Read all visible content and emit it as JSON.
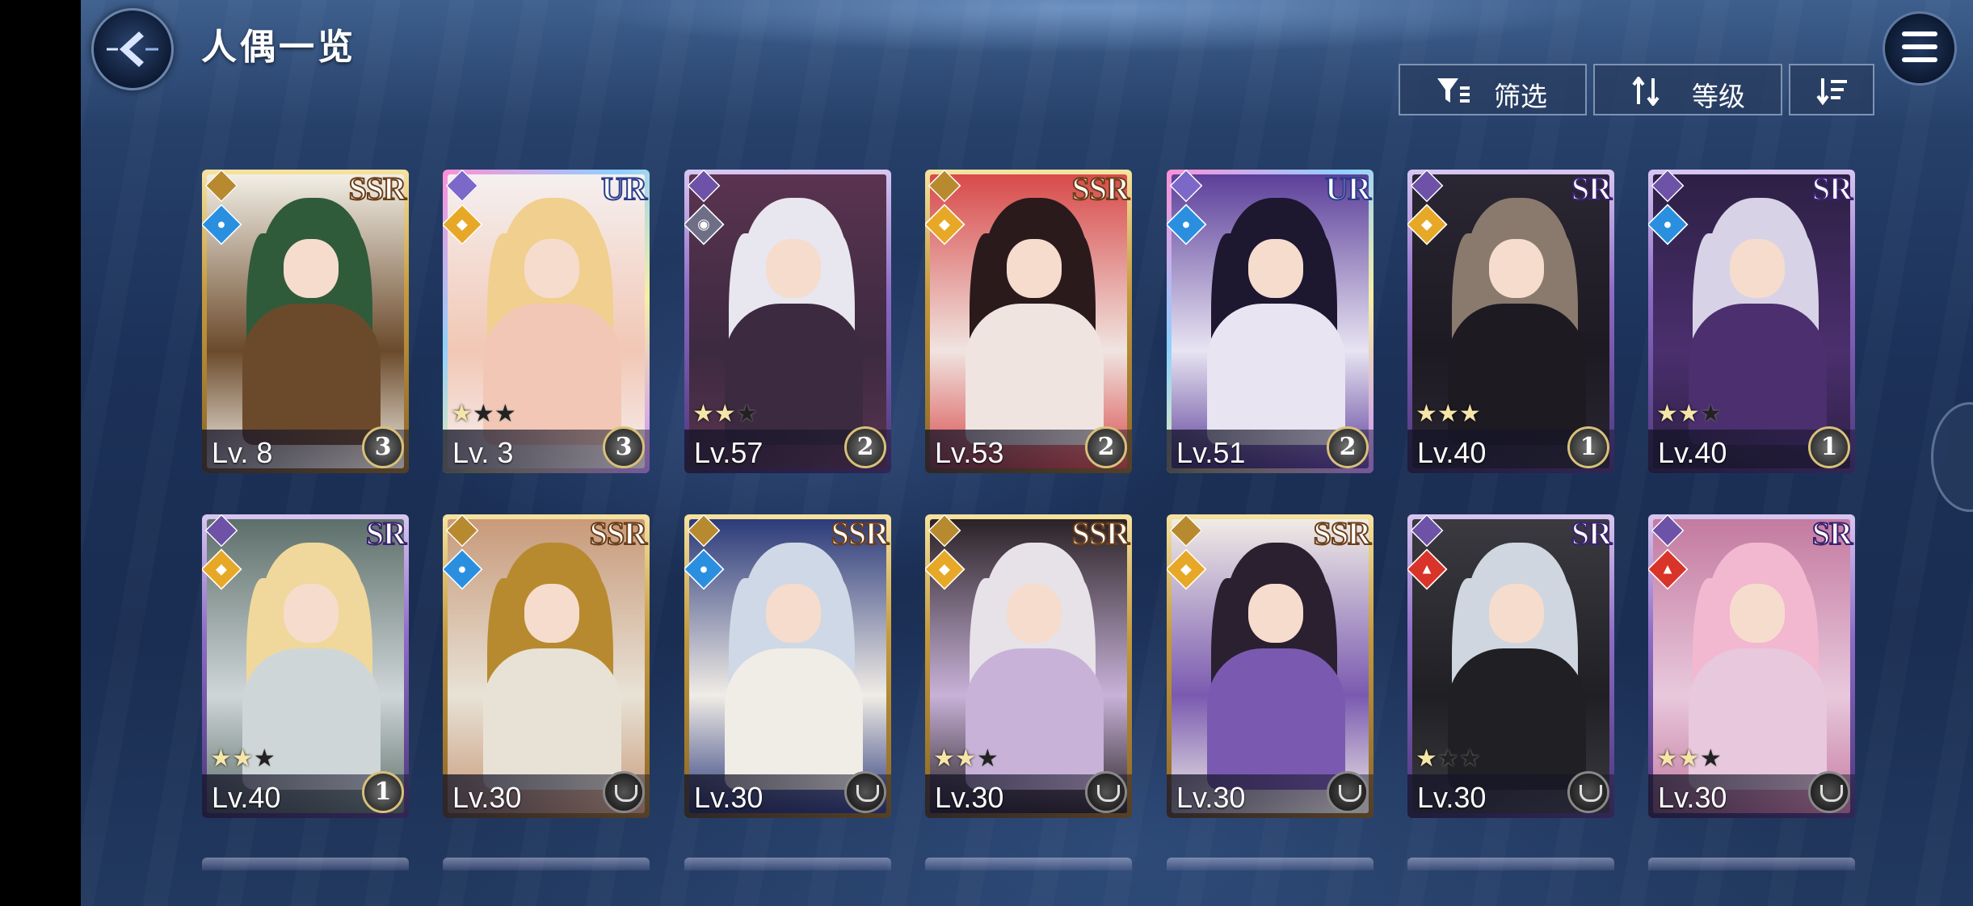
{
  "header": {
    "title": "人偶一览",
    "filter_label": "筛选",
    "sort_label": "等级"
  },
  "cards": [
    {
      "rarity": "SSR",
      "frame": "gold",
      "element": "water",
      "level": "Lv. 8",
      "stars": 0,
      "badge": "3",
      "art": [
        "#2f5b3a",
        "#6b4a2b",
        "#f2efe6"
      ]
    },
    {
      "rarity": "UR",
      "frame": "ur",
      "element": "light",
      "level": "Lv. 3",
      "stars": 1,
      "badge": "3",
      "art": [
        "#f1cf8e",
        "#f2c7b5",
        "#f5f0f0"
      ]
    },
    {
      "rarity": "",
      "frame": "purple",
      "element": "dark",
      "level": "Lv.57",
      "stars": 2,
      "badge": "2",
      "art": [
        "#e8e6ee",
        "#3c2a40",
        "#5a3350"
      ]
    },
    {
      "rarity": "SSR",
      "frame": "gold",
      "element": "light",
      "level": "Lv.53",
      "stars": 0,
      "badge": "2",
      "art": [
        "#2b1a1c",
        "#f0e4e0",
        "#d84a4a"
      ]
    },
    {
      "rarity": "UR",
      "frame": "ur",
      "element": "water",
      "level": "Lv.51",
      "stars": 0,
      "badge": "2",
      "art": [
        "#1d1730",
        "#e8e4f2",
        "#5c3f9a"
      ]
    },
    {
      "rarity": "SR",
      "frame": "purple",
      "element": "light",
      "level": "Lv.40",
      "stars": 3,
      "badge": "1",
      "art": [
        "#8a7a6e",
        "#1d1a22",
        "#2a2633"
      ]
    },
    {
      "rarity": "SR",
      "frame": "purple",
      "element": "water",
      "level": "Lv.40",
      "stars": 2,
      "badge": "1",
      "art": [
        "#d8d2e6",
        "#4b2f6e",
        "#2d2044"
      ]
    },
    {
      "rarity": "SR",
      "frame": "purple",
      "element": "light",
      "level": "Lv.40",
      "stars": 2,
      "badge": "1",
      "art": [
        "#f0d89c",
        "#cfd6d8",
        "#5d6f6a"
      ]
    },
    {
      "rarity": "SSR",
      "frame": "gold",
      "element": "water",
      "level": "Lv.30",
      "stars": 0,
      "badge": "",
      "art": [
        "#b88a2f",
        "#e8e2d6",
        "#c89a7a"
      ]
    },
    {
      "rarity": "SSR",
      "frame": "gold",
      "element": "water",
      "level": "Lv.30",
      "stars": 0,
      "badge": "",
      "art": [
        "#cfd8e6",
        "#f0ece6",
        "#2b3a7a"
      ]
    },
    {
      "rarity": "SSR",
      "frame": "gold",
      "element": "light",
      "level": "Lv.30",
      "stars": 2,
      "badge": "",
      "art": [
        "#e6e2e8",
        "#c8b2d8",
        "#2a2226"
      ]
    },
    {
      "rarity": "SSR",
      "frame": "gold",
      "element": "light",
      "level": "Lv.30",
      "stars": 0,
      "badge": "",
      "art": [
        "#2a2030",
        "#7a5ab0",
        "#f0ece6"
      ]
    },
    {
      "rarity": "SR",
      "frame": "purple",
      "element": "fire",
      "level": "Lv.30",
      "stars": 1,
      "badge": "",
      "art": [
        "#cfd6e0",
        "#1f1f24",
        "#3a3a40"
      ]
    },
    {
      "rarity": "SR",
      "frame": "purple",
      "element": "fire",
      "level": "Lv.30",
      "stars": 2,
      "badge": "",
      "art": [
        "#f2b8d0",
        "#e8c8dc",
        "#c47aa0"
      ]
    }
  ]
}
